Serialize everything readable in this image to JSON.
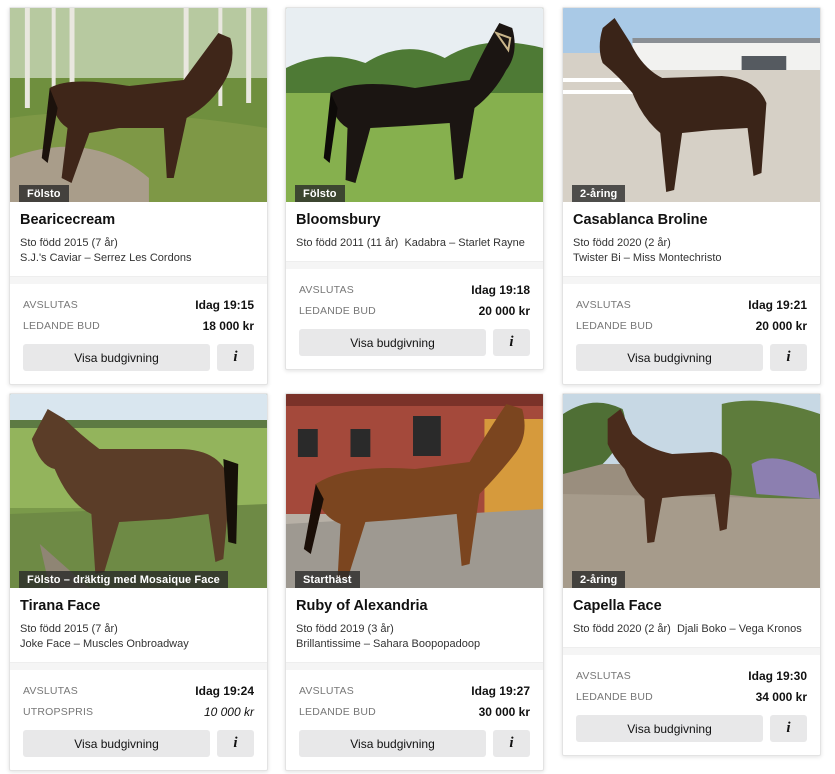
{
  "labels": {
    "ends": "AVSLUTAS",
    "leading_bid": "LEDANDE BUD",
    "reserve_price": "UTROPSPRIS",
    "view_bidding": "Visa budgivning",
    "info": "i"
  },
  "colors": {
    "button_bg": "#e8e8e9",
    "badge_bg": "#282828",
    "divider_bg": "#f5f5f5"
  },
  "cards": [
    {
      "badge": "Fölsto",
      "name": "Bearicecream",
      "born": "Sto född 2015 (7 år)",
      "pedigree": "S.J.'s Caviar – Serrez Les Cordons",
      "ends": "Idag 19:15",
      "price_label": "LEDANDE BUD",
      "price": "18 000 kr"
    },
    {
      "badge": "Fölsto",
      "name": "Bloomsbury",
      "born": "Sto född 2011 (11 år)",
      "pedigree": "Kadabra – Starlet Rayne",
      "ends": "Idag 19:18",
      "price_label": "LEDANDE BUD",
      "price": "20 000 kr"
    },
    {
      "badge": "2-åring",
      "name": "Casablanca Broline",
      "born": "Sto född 2020 (2 år)",
      "pedigree": "Twister Bi – Miss Montechristo",
      "ends": "Idag 19:21",
      "price_label": "LEDANDE BUD",
      "price": "20 000 kr"
    },
    {
      "badge": "Fölsto – dräktig med Mosaique Face",
      "name": "Tirana Face",
      "born": "Sto född 2015 (7 år)",
      "pedigree": "Joke Face – Muscles Onbroadway",
      "ends": "Idag 19:24",
      "price_label": "UTROPSPRIS",
      "price": "10 000 kr"
    },
    {
      "badge": "Starthäst",
      "name": "Ruby of Alexandria",
      "born": "Sto född 2019 (3 år)",
      "pedigree": "Brillantissime – Sahara Boopopadoop",
      "ends": "Idag 19:27",
      "price_label": "LEDANDE BUD",
      "price": "30 000 kr"
    },
    {
      "badge": "2-åring",
      "name": "Capella Face",
      "born": "Sto född 2020 (2 år)",
      "pedigree": "Djali Boko – Vega Kronos",
      "ends": "Idag 19:30",
      "price_label": "LEDANDE BUD",
      "price": "34 000 kr"
    }
  ]
}
